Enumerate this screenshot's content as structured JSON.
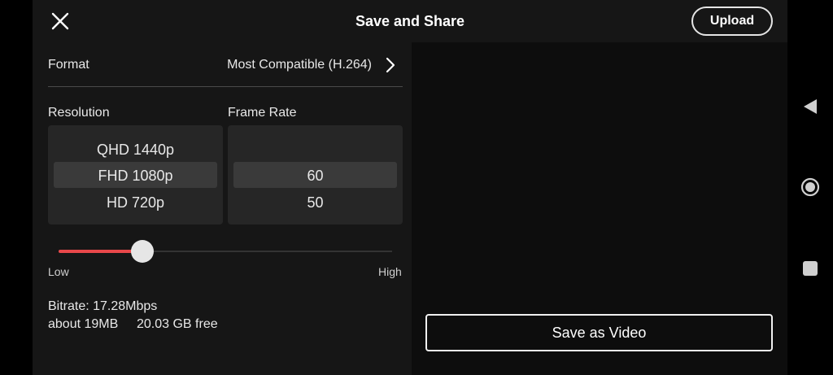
{
  "header": {
    "title": "Save and Share",
    "upload_label": "Upload",
    "close_icon": "close-icon"
  },
  "format": {
    "label": "Format",
    "value": "Most Compatible (H.264)",
    "chevron_icon": "chevron-right-icon"
  },
  "resolution": {
    "label": "Resolution",
    "options": [
      "QHD 1440p",
      "FHD 1080p",
      "HD 720p"
    ],
    "selected": "FHD 1080p"
  },
  "frame_rate": {
    "label": "Frame Rate",
    "options": [
      "",
      "60",
      "50"
    ],
    "selected": "60"
  },
  "quality_slider": {
    "low_label": "Low",
    "high_label": "High",
    "level": 0.25
  },
  "info": {
    "bitrate": "Bitrate: 17.28Mbps",
    "size": "about 19MB",
    "free": "20.03 GB free"
  },
  "save_label": "Save as Video",
  "colors": {
    "accent": "#e8484a",
    "background": "#161616",
    "panel": "#262626"
  },
  "system_nav": {
    "back_icon": "back-triangle-icon",
    "home_icon": "home-circle-icon",
    "recent_icon": "recent-square-icon"
  }
}
